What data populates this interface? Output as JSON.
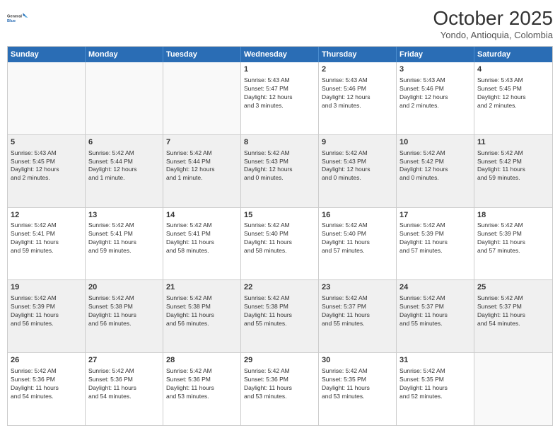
{
  "logo": {
    "general": "General",
    "blue": "Blue"
  },
  "header": {
    "title": "October 2025",
    "subtitle": "Yondo, Antioquia, Colombia"
  },
  "days": [
    "Sunday",
    "Monday",
    "Tuesday",
    "Wednesday",
    "Thursday",
    "Friday",
    "Saturday"
  ],
  "rows": [
    [
      {
        "day": "",
        "text": ""
      },
      {
        "day": "",
        "text": ""
      },
      {
        "day": "",
        "text": ""
      },
      {
        "day": "1",
        "text": "Sunrise: 5:43 AM\nSunset: 5:47 PM\nDaylight: 12 hours\nand 3 minutes."
      },
      {
        "day": "2",
        "text": "Sunrise: 5:43 AM\nSunset: 5:46 PM\nDaylight: 12 hours\nand 3 minutes."
      },
      {
        "day": "3",
        "text": "Sunrise: 5:43 AM\nSunset: 5:46 PM\nDaylight: 12 hours\nand 2 minutes."
      },
      {
        "day": "4",
        "text": "Sunrise: 5:43 AM\nSunset: 5:45 PM\nDaylight: 12 hours\nand 2 minutes."
      }
    ],
    [
      {
        "day": "5",
        "text": "Sunrise: 5:43 AM\nSunset: 5:45 PM\nDaylight: 12 hours\nand 2 minutes."
      },
      {
        "day": "6",
        "text": "Sunrise: 5:42 AM\nSunset: 5:44 PM\nDaylight: 12 hours\nand 1 minute."
      },
      {
        "day": "7",
        "text": "Sunrise: 5:42 AM\nSunset: 5:44 PM\nDaylight: 12 hours\nand 1 minute."
      },
      {
        "day": "8",
        "text": "Sunrise: 5:42 AM\nSunset: 5:43 PM\nDaylight: 12 hours\nand 0 minutes."
      },
      {
        "day": "9",
        "text": "Sunrise: 5:42 AM\nSunset: 5:43 PM\nDaylight: 12 hours\nand 0 minutes."
      },
      {
        "day": "10",
        "text": "Sunrise: 5:42 AM\nSunset: 5:42 PM\nDaylight: 12 hours\nand 0 minutes."
      },
      {
        "day": "11",
        "text": "Sunrise: 5:42 AM\nSunset: 5:42 PM\nDaylight: 11 hours\nand 59 minutes."
      }
    ],
    [
      {
        "day": "12",
        "text": "Sunrise: 5:42 AM\nSunset: 5:41 PM\nDaylight: 11 hours\nand 59 minutes."
      },
      {
        "day": "13",
        "text": "Sunrise: 5:42 AM\nSunset: 5:41 PM\nDaylight: 11 hours\nand 59 minutes."
      },
      {
        "day": "14",
        "text": "Sunrise: 5:42 AM\nSunset: 5:41 PM\nDaylight: 11 hours\nand 58 minutes."
      },
      {
        "day": "15",
        "text": "Sunrise: 5:42 AM\nSunset: 5:40 PM\nDaylight: 11 hours\nand 58 minutes."
      },
      {
        "day": "16",
        "text": "Sunrise: 5:42 AM\nSunset: 5:40 PM\nDaylight: 11 hours\nand 57 minutes."
      },
      {
        "day": "17",
        "text": "Sunrise: 5:42 AM\nSunset: 5:39 PM\nDaylight: 11 hours\nand 57 minutes."
      },
      {
        "day": "18",
        "text": "Sunrise: 5:42 AM\nSunset: 5:39 PM\nDaylight: 11 hours\nand 57 minutes."
      }
    ],
    [
      {
        "day": "19",
        "text": "Sunrise: 5:42 AM\nSunset: 5:39 PM\nDaylight: 11 hours\nand 56 minutes."
      },
      {
        "day": "20",
        "text": "Sunrise: 5:42 AM\nSunset: 5:38 PM\nDaylight: 11 hours\nand 56 minutes."
      },
      {
        "day": "21",
        "text": "Sunrise: 5:42 AM\nSunset: 5:38 PM\nDaylight: 11 hours\nand 56 minutes."
      },
      {
        "day": "22",
        "text": "Sunrise: 5:42 AM\nSunset: 5:38 PM\nDaylight: 11 hours\nand 55 minutes."
      },
      {
        "day": "23",
        "text": "Sunrise: 5:42 AM\nSunset: 5:37 PM\nDaylight: 11 hours\nand 55 minutes."
      },
      {
        "day": "24",
        "text": "Sunrise: 5:42 AM\nSunset: 5:37 PM\nDaylight: 11 hours\nand 55 minutes."
      },
      {
        "day": "25",
        "text": "Sunrise: 5:42 AM\nSunset: 5:37 PM\nDaylight: 11 hours\nand 54 minutes."
      }
    ],
    [
      {
        "day": "26",
        "text": "Sunrise: 5:42 AM\nSunset: 5:36 PM\nDaylight: 11 hours\nand 54 minutes."
      },
      {
        "day": "27",
        "text": "Sunrise: 5:42 AM\nSunset: 5:36 PM\nDaylight: 11 hours\nand 54 minutes."
      },
      {
        "day": "28",
        "text": "Sunrise: 5:42 AM\nSunset: 5:36 PM\nDaylight: 11 hours\nand 53 minutes."
      },
      {
        "day": "29",
        "text": "Sunrise: 5:42 AM\nSunset: 5:36 PM\nDaylight: 11 hours\nand 53 minutes."
      },
      {
        "day": "30",
        "text": "Sunrise: 5:42 AM\nSunset: 5:35 PM\nDaylight: 11 hours\nand 53 minutes."
      },
      {
        "day": "31",
        "text": "Sunrise: 5:42 AM\nSunset: 5:35 PM\nDaylight: 11 hours\nand 52 minutes."
      },
      {
        "day": "",
        "text": ""
      }
    ]
  ]
}
